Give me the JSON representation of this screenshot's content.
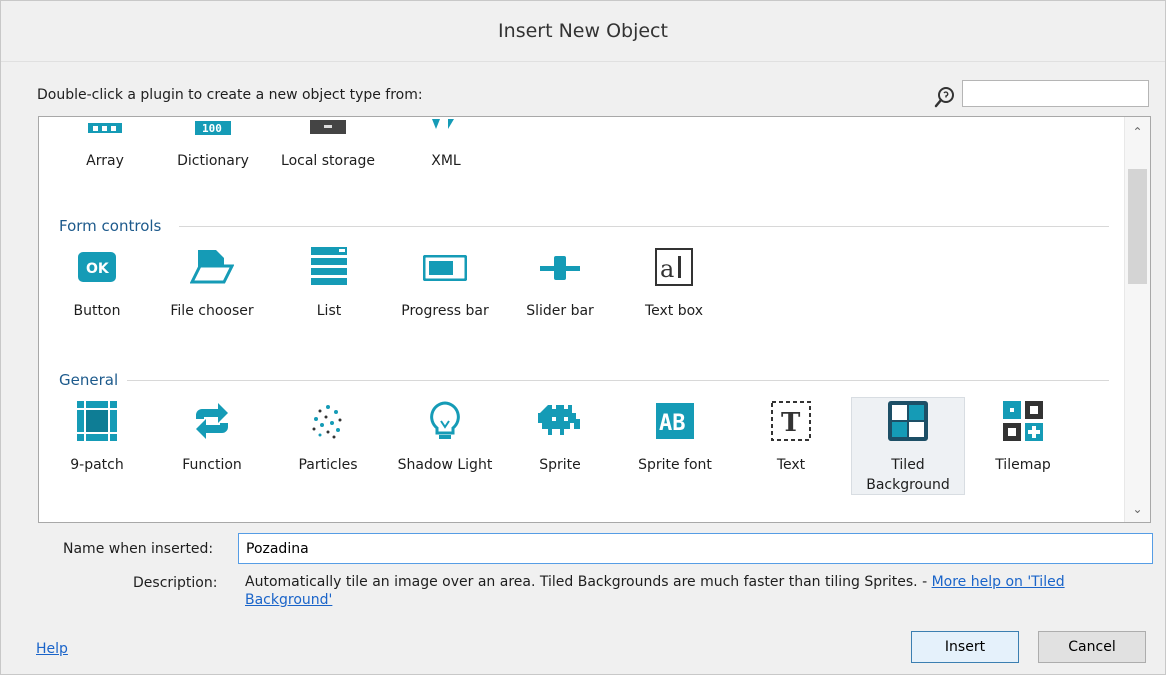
{
  "dialog": {
    "title": "Insert New Object",
    "instruction": "Double-click a plugin to create a new object type from:",
    "search": {
      "value": ""
    }
  },
  "plugins": {
    "data": [
      "Array",
      "Dictionary",
      "Local storage",
      "XML"
    ],
    "form_controls_title": "Form controls",
    "form_controls": [
      "Button",
      "File chooser",
      "List",
      "Progress bar",
      "Slider bar",
      "Text box"
    ],
    "general_title": "General",
    "general": [
      "9-patch",
      "Function",
      "Particles",
      "Shadow Light",
      "Sprite",
      "Sprite font",
      "Text",
      "Tiled Background",
      "Tilemap"
    ],
    "selected": "Tiled Background"
  },
  "name_label": "Name when inserted:",
  "name_value": "Pozadina",
  "description_label": "Description:",
  "description_text": "Automatically tile an image over an area.  Tiled Backgrounds are much faster than tiling Sprites. - ",
  "description_link": "More help on 'Tiled Background'",
  "help_link": "Help",
  "buttons": {
    "insert": "Insert",
    "cancel": "Cancel"
  },
  "colors": {
    "accent": "#1a64c9",
    "icon": "#159bb6"
  }
}
